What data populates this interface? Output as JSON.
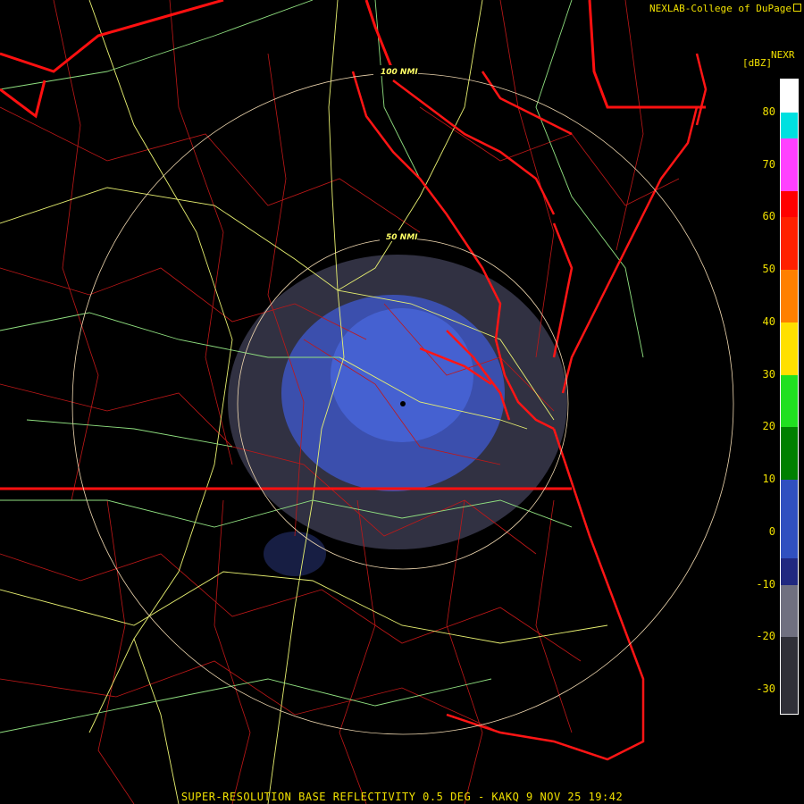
{
  "header": {
    "credit": "NEXLAB-College of DuPage"
  },
  "legend": {
    "product": "NEXR",
    "unit": "[dBZ]",
    "ticks": [
      "80",
      "70",
      "60",
      "50",
      "40",
      "30",
      "20",
      "10",
      "0",
      "-10",
      "-20",
      "-30"
    ],
    "bands": [
      {
        "from": 80,
        "to": 90,
        "color": "#ffffff"
      },
      {
        "from": 75,
        "to": 80,
        "color": "#00e0e0"
      },
      {
        "from": 65,
        "to": 75,
        "color": "#ff40ff"
      },
      {
        "from": 60,
        "to": 65,
        "color": "#ff0000"
      },
      {
        "from": 50,
        "to": 60,
        "color": "#ff2000"
      },
      {
        "from": 40,
        "to": 50,
        "color": "#ff8000"
      },
      {
        "from": 30,
        "to": 40,
        "color": "#ffe000"
      },
      {
        "from": 20,
        "to": 30,
        "color": "#20e020"
      },
      {
        "from": 10,
        "to": 20,
        "color": "#008000"
      },
      {
        "from": -5,
        "to": 10,
        "color": "#3050c0"
      },
      {
        "from": -10,
        "to": -5,
        "color": "#202880"
      },
      {
        "from": -20,
        "to": -10,
        "color": "#707080"
      },
      {
        "from": -35,
        "to": -20,
        "color": "#303038"
      }
    ]
  },
  "range_rings": {
    "inner": "50 NMI",
    "outer": "100 NMI"
  },
  "colors": {
    "state_lines": "#ff1010",
    "county_lines": "#d01818",
    "highways": "#e8f070",
    "interstates": "#a0e890",
    "rings": "#f0d8b0",
    "echo": "#4a64d0"
  },
  "caption": "SUPER-RESOLUTION BASE REFLECTIVITY 0.5 DEG - KAKQ 9 NOV 25 19:42"
}
